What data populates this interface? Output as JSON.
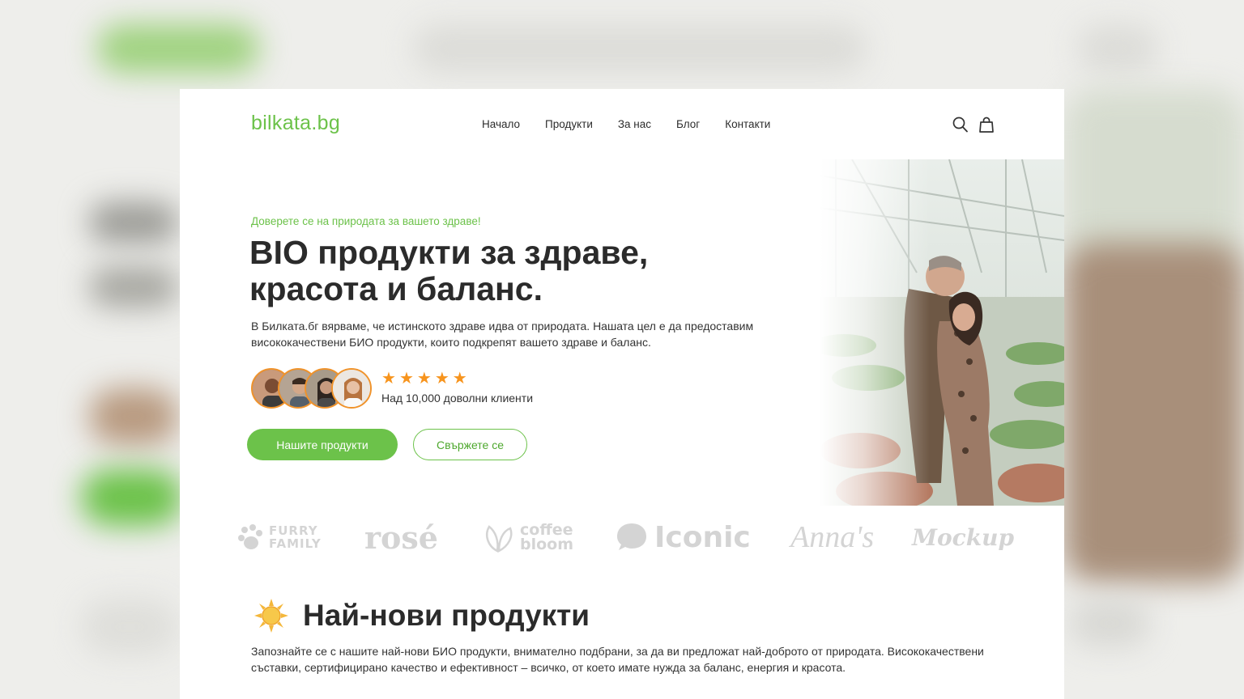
{
  "header": {
    "logo": "bilkata.bg",
    "nav": [
      "Начало",
      "Продукти",
      "За нас",
      "Блог",
      "Контакти"
    ],
    "icons": [
      "search-icon",
      "shopping-bag-icon"
    ]
  },
  "hero": {
    "eyebrow": "Доверете се на природата за вашето здраве!",
    "title": "BIO продукти за здраве, красота и баланс.",
    "description": "В Билката.бг вярваме, че истинското здраве идва от природата. Нашата цел е да предоставим висококачествени БИО продукти, които подкрепят вашето здраве и баланс.",
    "rating_stars": 5,
    "clients_text": "Над 10,000 доволни клиенти",
    "primary_button": "Нашите продукти",
    "secondary_button": "Свържете се"
  },
  "brands": {
    "furry": [
      "FURRY",
      "FAMILY"
    ],
    "rose": "rosé",
    "coffee": [
      "coffee",
      "bloom"
    ],
    "iconic": "Iconic",
    "annas": "Anna's",
    "mockup": "Mockup"
  },
  "latest": {
    "title": "Най-нови продукти",
    "description": "Запознайте се с нашите най-нови БИО продукти, внимателно подбрани, за да ви предложат най-доброто от природата. Висококачествени съставки, сертифицирано качество и ефективност – всичко, от което имате нужда за баланс, енергия и красота."
  },
  "colors": {
    "accent": "#6cc24a",
    "star": "#f7941d",
    "text": "#2b2b2b"
  }
}
